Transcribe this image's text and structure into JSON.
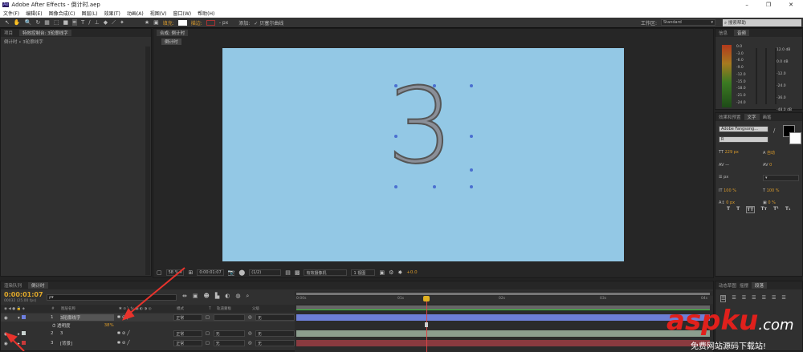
{
  "window": {
    "title": "Adobe After Effects - 倒计时.aep",
    "min": "–",
    "restore": "❐",
    "close": "✕"
  },
  "menu": [
    "文件(F)",
    "编辑(E)",
    "图像合成(C)",
    "图层(L)",
    "效果(T)",
    "动画(A)",
    "视图(V)",
    "窗口(W)",
    "帮助(H)"
  ],
  "toolbar": {
    "fill_label": "填充:",
    "stroke_label": "描边:",
    "px": "- px",
    "add_label": "添加:",
    "bezier_label": "✓ 贝塞尔曲线",
    "workspace_label": "工作区:",
    "workspace_value": "Standard",
    "search_placeholder": "搜索帮助"
  },
  "left_panel": {
    "tabs": [
      "项目",
      "特效控制台: 3轮廓线字"
    ],
    "breadcrumb": "倒计时 • 3轮廓线字"
  },
  "viewer": {
    "tab": "合成: 倒计时",
    "subtab": "倒计时",
    "digit": "3",
    "zoom": "58 %",
    "timecode": "0:00:01:07",
    "resolution": "(1/2)",
    "camera": "有效摄像机",
    "views": "1 视图",
    "exposure": "+0.0"
  },
  "right_top": {
    "tabs": [
      "信息",
      "音频"
    ],
    "levels": [
      "0.0",
      "-3.0",
      "-6.0",
      "-9.0",
      "-12.0",
      "-15.0",
      "-18.0",
      "-21.0",
      "-24.0"
    ],
    "db": [
      "12.0 dB",
      "0.0 dB",
      "-12.0",
      "-24.0",
      "-36.0",
      "-48.0 dB"
    ]
  },
  "character": {
    "tabs": [
      "效果和预置",
      "文字",
      "画笔"
    ],
    "font": "Adobe Fangsong...",
    "style": "R",
    "size": "229 px",
    "leading": "自动",
    "tracking": "0",
    "units": "px",
    "vscale": "100 %",
    "hscale": "100 %",
    "baseline": "0 px",
    "tsume": "0 %"
  },
  "paragraph": {
    "tabs": [
      "动态草图",
      "摇摆",
      "段落"
    ]
  },
  "timeline": {
    "tabs": [
      "渲染队列",
      "倒计时"
    ],
    "timecode": "0:00:01:07",
    "fps": "00032 (25.00 fps)",
    "search_placeholder": "ρ▾",
    "columns": [
      "#",
      "图层名称",
      "模式",
      "T",
      "轨道蒙板",
      "父级"
    ],
    "ruler": [
      "0:00s",
      "01s",
      "02s",
      "03s",
      "04s"
    ],
    "layers": [
      {
        "num": "1",
        "name": "3轮廓线字",
        "mode": "正常",
        "track": "",
        "parent": "无",
        "color": "#6e7fe0",
        "bar": "#6d7fd6"
      },
      {
        "num": "2",
        "name": "3",
        "mode": "正常",
        "track": "无",
        "parent": "无",
        "color": "#c9d3d0",
        "bar": "#8c9e8e"
      },
      {
        "num": "3",
        "name": "[背景]",
        "mode": "正常",
        "track": "无",
        "parent": "无",
        "color": "#c83a3a",
        "bar": "#8a3a3f"
      }
    ],
    "opacity_label": "透明度",
    "opacity_value": "38%"
  },
  "watermark": {
    "brand": "aspku",
    "domain": ".com",
    "tagline": "免费网站源码下载站!"
  }
}
